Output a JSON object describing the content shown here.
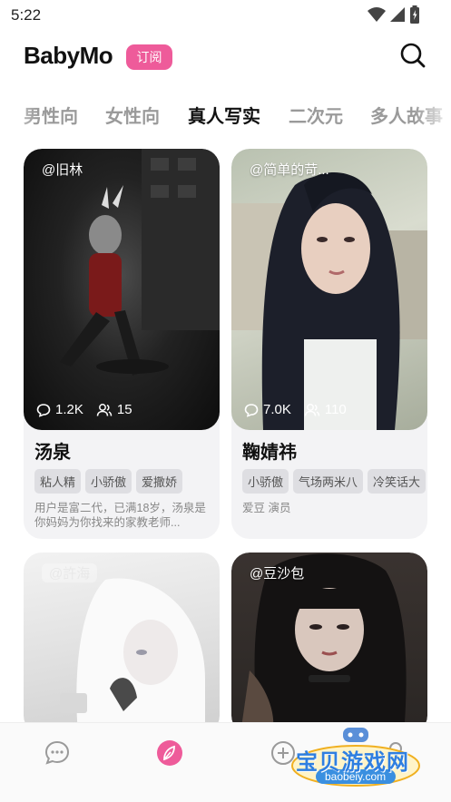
{
  "status": {
    "time": "5:22"
  },
  "header": {
    "logo": "BabyMo",
    "subscribe": "订阅"
  },
  "tabs": [
    {
      "label": "男性向"
    },
    {
      "label": "女性向"
    },
    {
      "label": "真人写实"
    },
    {
      "label": "二次元"
    },
    {
      "label": "多人故事"
    }
  ],
  "cards": [
    {
      "handle": "@旧林",
      "chats": "1.2K",
      "followers": "15",
      "title": "汤泉",
      "tags": [
        "粘人精",
        "小骄傲",
        "爱撒娇"
      ],
      "desc": "用户是富二代，已满18岁，汤泉是你妈妈为你找来的家教老师..."
    },
    {
      "handle": "@简单的苛...",
      "chats": "7.0K",
      "followers": "110",
      "title": "鞠婧祎",
      "tags": [
        "小骄傲",
        "气场两米八",
        "冷笑话大"
      ],
      "desc": "爱豆 演员"
    },
    {
      "handle": "@許海",
      "chats": "",
      "followers": "",
      "title": "",
      "tags": [],
      "desc": ""
    },
    {
      "handle": "@豆沙包",
      "chats": "",
      "followers": "",
      "title": "",
      "tags": [],
      "desc": ""
    }
  ],
  "watermark": {
    "text": "宝贝游戏网",
    "url": "baobeiy.com"
  },
  "colors": {
    "accent": "#ee5b9a",
    "tab_inactive": "#9a9a9a"
  }
}
